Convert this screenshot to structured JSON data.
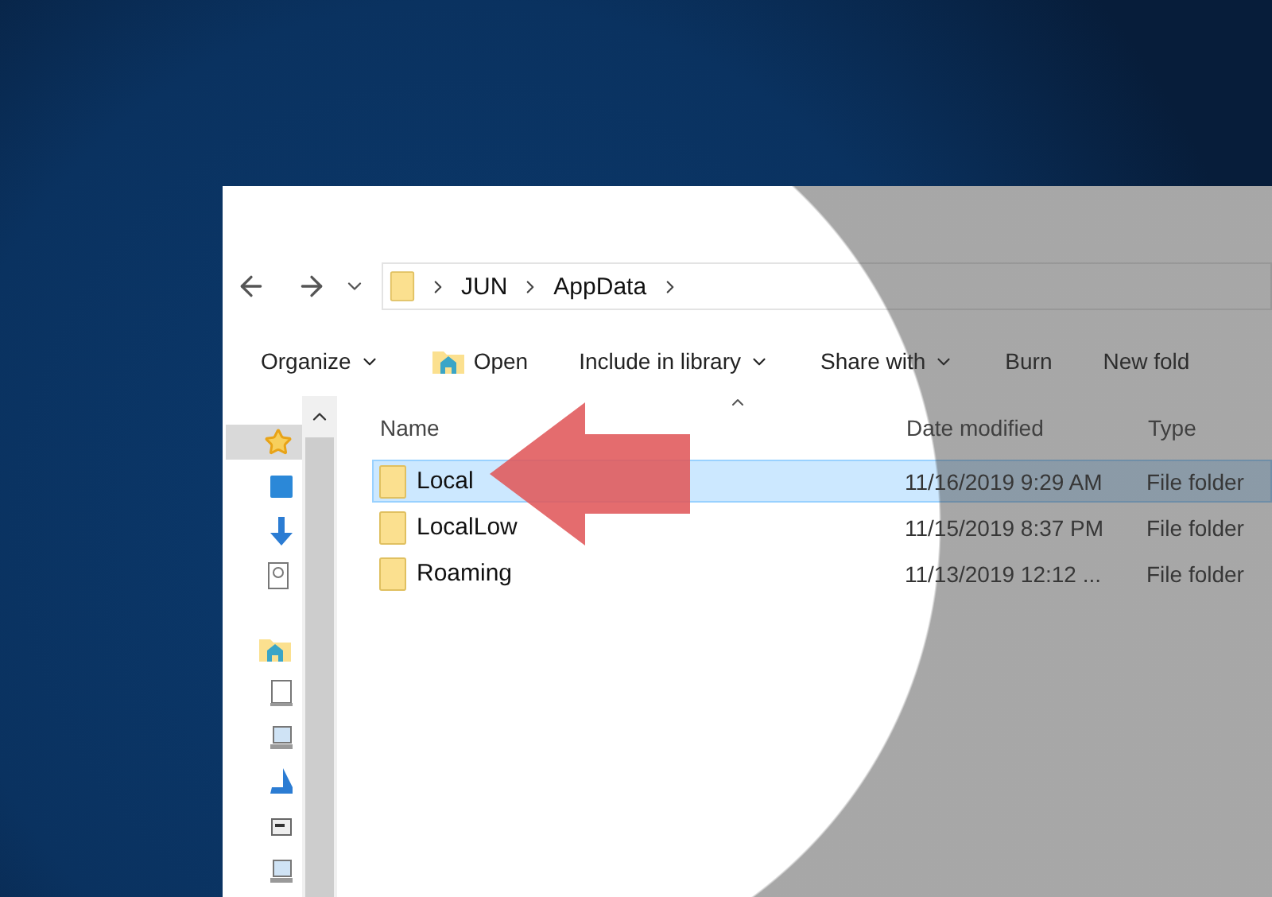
{
  "address_bar": {
    "path": [
      "JUN",
      "AppData"
    ]
  },
  "toolbar": [
    {
      "label": "Organize",
      "kind": "menu"
    },
    {
      "label": "Open",
      "kind": "open"
    },
    {
      "label": "Include in library",
      "kind": "menu"
    },
    {
      "label": "Share with",
      "kind": "menu"
    },
    {
      "label": "Burn",
      "kind": "plain"
    },
    {
      "label": "New fold",
      "kind": "plain"
    }
  ],
  "table": {
    "columns": [
      "Name",
      "Date modified",
      "Type"
    ],
    "rows": [
      {
        "name": "Local",
        "date": "11/16/2019 9:29 AM",
        "type": "File folder",
        "selected": true
      },
      {
        "name": "LocalLow",
        "date": "11/15/2019 8:37 PM",
        "type": "File folder",
        "selected": false
      },
      {
        "name": "Roaming",
        "date": "11/13/2019 12:12 ...",
        "type": "File folder",
        "selected": false
      }
    ]
  }
}
